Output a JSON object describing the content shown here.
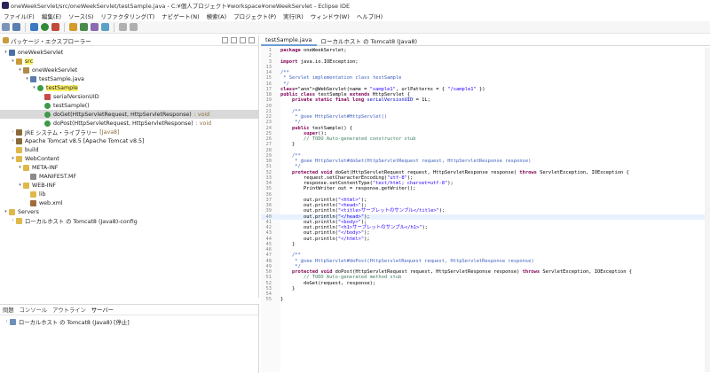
{
  "window": {
    "title": "oneWeekServlet/src/oneWeekServlet/testSample.java - C:¥個人プロジェクト¥workspace¥oneWeekServlet - Eclipse IDE"
  },
  "menu": [
    "ファイル(F)",
    "編集(E)",
    "ソース(S)",
    "リファクタリング(T)",
    "ナビゲート(N)",
    "検索(A)",
    "プロジェクト(P)",
    "実行(R)",
    "ウィンドウ(W)",
    "ヘルプ(H)"
  ],
  "package_explorer": {
    "title": "パッケージ・エクスプローラー",
    "tree": [
      {
        "indent": 0,
        "twisty": "▾",
        "icon": "project-icon",
        "label": "oneWeekServlet"
      },
      {
        "indent": 1,
        "twisty": "▾",
        "icon": "src-folder-icon",
        "label": "src",
        "highlight": true
      },
      {
        "indent": 2,
        "twisty": "▾",
        "icon": "package-icon",
        "label": "oneWeekServlet"
      },
      {
        "indent": 3,
        "twisty": "▾",
        "icon": "java-file-icon",
        "label": "testSample.java"
      },
      {
        "indent": 4,
        "twisty": "▾",
        "icon": "class-icon",
        "label": "testSample",
        "highlight": true
      },
      {
        "indent": 5,
        "twisty": "",
        "icon": "field-icon",
        "label": "serialVersionUID"
      },
      {
        "indent": 5,
        "twisty": "",
        "icon": "method-icon",
        "label": "testSample()"
      },
      {
        "indent": 5,
        "twisty": "",
        "icon": "method-icon",
        "label": "doGet(HttpServletRequest, HttpServletResponse)",
        "ret": ": void",
        "selected": true
      },
      {
        "indent": 5,
        "twisty": "",
        "icon": "method-icon",
        "label": "doPost(HttpServletRequest, HttpServletResponse)",
        "ret": ": void"
      },
      {
        "indent": 1,
        "twisty": "›",
        "icon": "library-icon",
        "label": "JRE システム・ライブラリー",
        "ret": "[Java8]"
      },
      {
        "indent": 1,
        "twisty": "›",
        "icon": "library-icon",
        "label": "Apache Tomcat v8.5 [Apache Tomcat v8.5]"
      },
      {
        "indent": 1,
        "twisty": "",
        "icon": "folder-icon",
        "label": "build"
      },
      {
        "indent": 1,
        "twisty": "▾",
        "icon": "folder-icon",
        "label": "WebContent"
      },
      {
        "indent": 2,
        "twisty": "▾",
        "icon": "folder-icon",
        "label": "META-INF"
      },
      {
        "indent": 3,
        "twisty": "",
        "icon": "file-icon",
        "label": "MANIFEST.MF"
      },
      {
        "indent": 2,
        "twisty": "▾",
        "icon": "folder-icon",
        "label": "WEB-INF"
      },
      {
        "indent": 3,
        "twisty": "",
        "icon": "folder-icon",
        "label": "lib"
      },
      {
        "indent": 3,
        "twisty": "",
        "icon": "xml-file-icon",
        "label": "web.xml"
      },
      {
        "indent": 0,
        "twisty": "▾",
        "icon": "folder-icon",
        "label": "Servers"
      },
      {
        "indent": 1,
        "twisty": "›",
        "icon": "folder-icon",
        "label": "ローカルホスト の Tomcat8 (Java8)-config"
      }
    ]
  },
  "bottom_panel": {
    "tabs": [
      "問題",
      "コンソール",
      "アウトライン",
      "サーバー"
    ],
    "active_tab": "サーバー",
    "server_row": "ローカルホスト の Tomcat8 (Java8)  [停止]"
  },
  "editor": {
    "tabs": [
      "testSample.java",
      "ローカルホスト の Tomcat8 (Java8)"
    ],
    "active_tab": "testSample.java",
    "current_line": 40,
    "lines": [
      {
        "n": "1",
        "t": "package oneWeekServlet;"
      },
      {
        "n": "2",
        "t": ""
      },
      {
        "n": "3",
        "t": "import java.io.IOException;"
      },
      {
        "n": "13",
        "t": ""
      },
      {
        "n": "14",
        "t": "/**"
      },
      {
        "n": "15",
        "t": " * Servlet implementation class testSample"
      },
      {
        "n": "16",
        "t": " */"
      },
      {
        "n": "17",
        "t": "@WebServlet(name = \"sample1\", urlPatterns = { \"/sample1\" })"
      },
      {
        "n": "18",
        "t": "public class testSample extends HttpServlet {"
      },
      {
        "n": "19",
        "t": "    private static final long serialVersionUID = 1L;"
      },
      {
        "n": "20",
        "t": ""
      },
      {
        "n": "21",
        "t": "    /**"
      },
      {
        "n": "22",
        "t": "     * @see HttpServlet#HttpServlet()"
      },
      {
        "n": "23",
        "t": "     */"
      },
      {
        "n": "24",
        "t": "    public testSample() {"
      },
      {
        "n": "25",
        "t": "        super();"
      },
      {
        "n": "26",
        "t": "        // TODO Auto-generated constructor stub"
      },
      {
        "n": "27",
        "t": "    }"
      },
      {
        "n": "28",
        "t": ""
      },
      {
        "n": "29",
        "t": "    /**"
      },
      {
        "n": "30",
        "t": "     * @see HttpServlet#doGet(HttpServletRequest request, HttpServletResponse response)"
      },
      {
        "n": "31",
        "t": "     */"
      },
      {
        "n": "32",
        "t": "    protected void doGet(HttpServletRequest request, HttpServletResponse response) throws ServletException, IOException {"
      },
      {
        "n": "33",
        "t": "        request.setCharacterEncoding(\"utf-8\");"
      },
      {
        "n": "34",
        "t": "        response.setContentType(\"text/html; charset=utf-8\");"
      },
      {
        "n": "35",
        "t": "        PrintWriter out = response.getWriter();"
      },
      {
        "n": "36",
        "t": ""
      },
      {
        "n": "37",
        "t": "        out.println(\"<html>\");"
      },
      {
        "n": "38",
        "t": "        out.println(\"<head>\");"
      },
      {
        "n": "39",
        "t": "        out.println(\"<title>サーブレットのサンプル</title>\");"
      },
      {
        "n": "40",
        "t": "        out.println(\"</head>\");"
      },
      {
        "n": "41",
        "t": "        out.println(\"<body>\");"
      },
      {
        "n": "42",
        "t": "        out.println(\"<h1>サーブレットのサンプル</h1>\");"
      },
      {
        "n": "43",
        "t": "        out.println(\"</body>\");"
      },
      {
        "n": "44",
        "t": "        out.println(\"</html>\");"
      },
      {
        "n": "45",
        "t": "    }"
      },
      {
        "n": "46",
        "t": ""
      },
      {
        "n": "47",
        "t": "    /**"
      },
      {
        "n": "48",
        "t": "     * @see HttpServlet#doPost(HttpServletRequest request, HttpServletResponse response)"
      },
      {
        "n": "49",
        "t": "     */"
      },
      {
        "n": "50",
        "t": "    protected void doPost(HttpServletRequest request, HttpServletResponse response) throws ServletException, IOException {"
      },
      {
        "n": "51",
        "t": "        // TODO Auto-generated method stub"
      },
      {
        "n": "52",
        "t": "        doGet(request, response);"
      },
      {
        "n": "53",
        "t": "    }"
      },
      {
        "n": "54",
        "t": ""
      },
      {
        "n": "55",
        "t": "}"
      }
    ]
  },
  "colors": {
    "keyword": "#7f0055",
    "comment": "#3f7f5f",
    "javadoc": "#3f5fbf",
    "string": "#2a00ff",
    "highlight": "#fff56a",
    "selection": "#d9d9d9"
  }
}
